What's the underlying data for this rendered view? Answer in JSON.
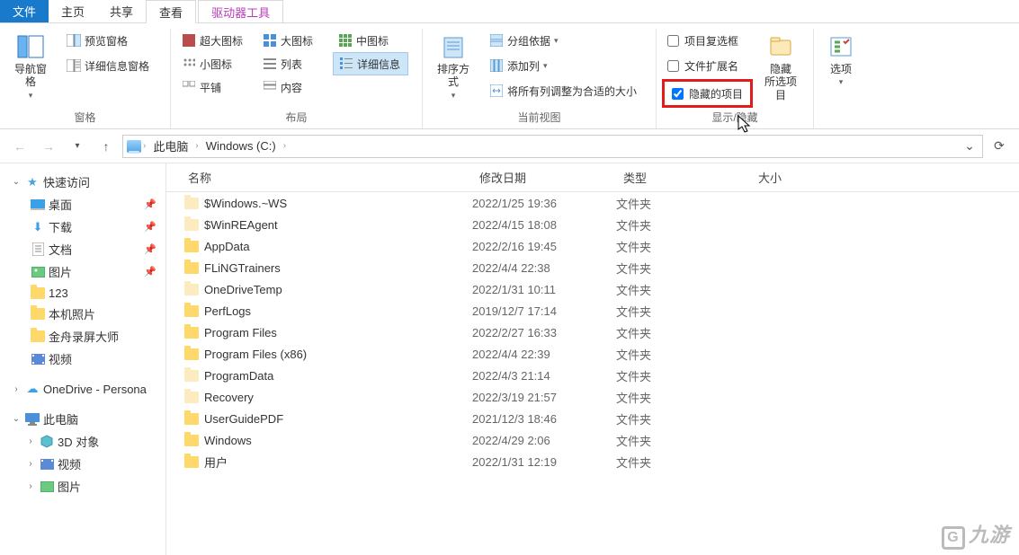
{
  "tabs": {
    "file": "文件",
    "home": "主页",
    "share": "共享",
    "view": "查看",
    "tools": "驱动器工具"
  },
  "ribbon": {
    "panes": {
      "nav_pane": "导航窗格",
      "preview_pane": "预览窗格",
      "details_pane": "详细信息窗格",
      "group_label": "窗格"
    },
    "layout": {
      "extra_large": "超大图标",
      "large": "大图标",
      "medium": "中图标",
      "small": "小图标",
      "list": "列表",
      "details": "详细信息",
      "tiles": "平铺",
      "content": "内容",
      "group_label": "布局"
    },
    "current_view": {
      "sort_by": "排序方式",
      "group_by": "分组依据",
      "add_columns": "添加列",
      "fit_columns": "将所有列调整为合适的大小",
      "group_label": "当前视图"
    },
    "show_hide": {
      "item_checkboxes": "项目复选框",
      "file_ext": "文件扩展名",
      "hidden_items": "隐藏的项目",
      "hide_selected": "隐藏\n所选项目",
      "group_label": "显示/隐藏",
      "checked": {
        "item_checkboxes": false,
        "file_ext": false,
        "hidden_items": true
      }
    },
    "options": {
      "label": "选项"
    }
  },
  "breadcrumb": {
    "this_pc": "此电脑",
    "drive": "Windows (C:)"
  },
  "columns": {
    "name": "名称",
    "date": "修改日期",
    "type": "类型",
    "size": "大小"
  },
  "files": [
    {
      "name": "$Windows.~WS",
      "date": "2022/1/25 19:36",
      "type": "文件夹",
      "pale": true
    },
    {
      "name": "$WinREAgent",
      "date": "2022/4/15 18:08",
      "type": "文件夹",
      "pale": true
    },
    {
      "name": "AppData",
      "date": "2022/2/16 19:45",
      "type": "文件夹",
      "pale": false
    },
    {
      "name": "FLiNGTrainers",
      "date": "2022/4/4 22:38",
      "type": "文件夹",
      "pale": false
    },
    {
      "name": "OneDriveTemp",
      "date": "2022/1/31 10:11",
      "type": "文件夹",
      "pale": true
    },
    {
      "name": "PerfLogs",
      "date": "2019/12/7 17:14",
      "type": "文件夹",
      "pale": false
    },
    {
      "name": "Program Files",
      "date": "2022/2/27 16:33",
      "type": "文件夹",
      "pale": false
    },
    {
      "name": "Program Files (x86)",
      "date": "2022/4/4 22:39",
      "type": "文件夹",
      "pale": false
    },
    {
      "name": "ProgramData",
      "date": "2022/4/3 21:14",
      "type": "文件夹",
      "pale": true
    },
    {
      "name": "Recovery",
      "date": "2022/3/19 21:57",
      "type": "文件夹",
      "pale": true
    },
    {
      "name": "UserGuidePDF",
      "date": "2021/12/3 18:46",
      "type": "文件夹",
      "pale": false
    },
    {
      "name": "Windows",
      "date": "2022/4/29 2:06",
      "type": "文件夹",
      "pale": false
    },
    {
      "name": "用户",
      "date": "2022/1/31 12:19",
      "type": "文件夹",
      "pale": false
    }
  ],
  "nav": {
    "quick_access": "快速访问",
    "desktop": "桌面",
    "downloads": "下载",
    "documents": "文档",
    "pictures": "图片",
    "folder_123": "123",
    "local_photos": "本机照片",
    "jinzhou": "金舟录屏大师",
    "videos": "视频",
    "onedrive": "OneDrive - Persona",
    "this_pc": "此电脑",
    "objects_3d": "3D 对象",
    "videos2": "视频",
    "pictures2": "图片"
  },
  "watermark": "九游"
}
